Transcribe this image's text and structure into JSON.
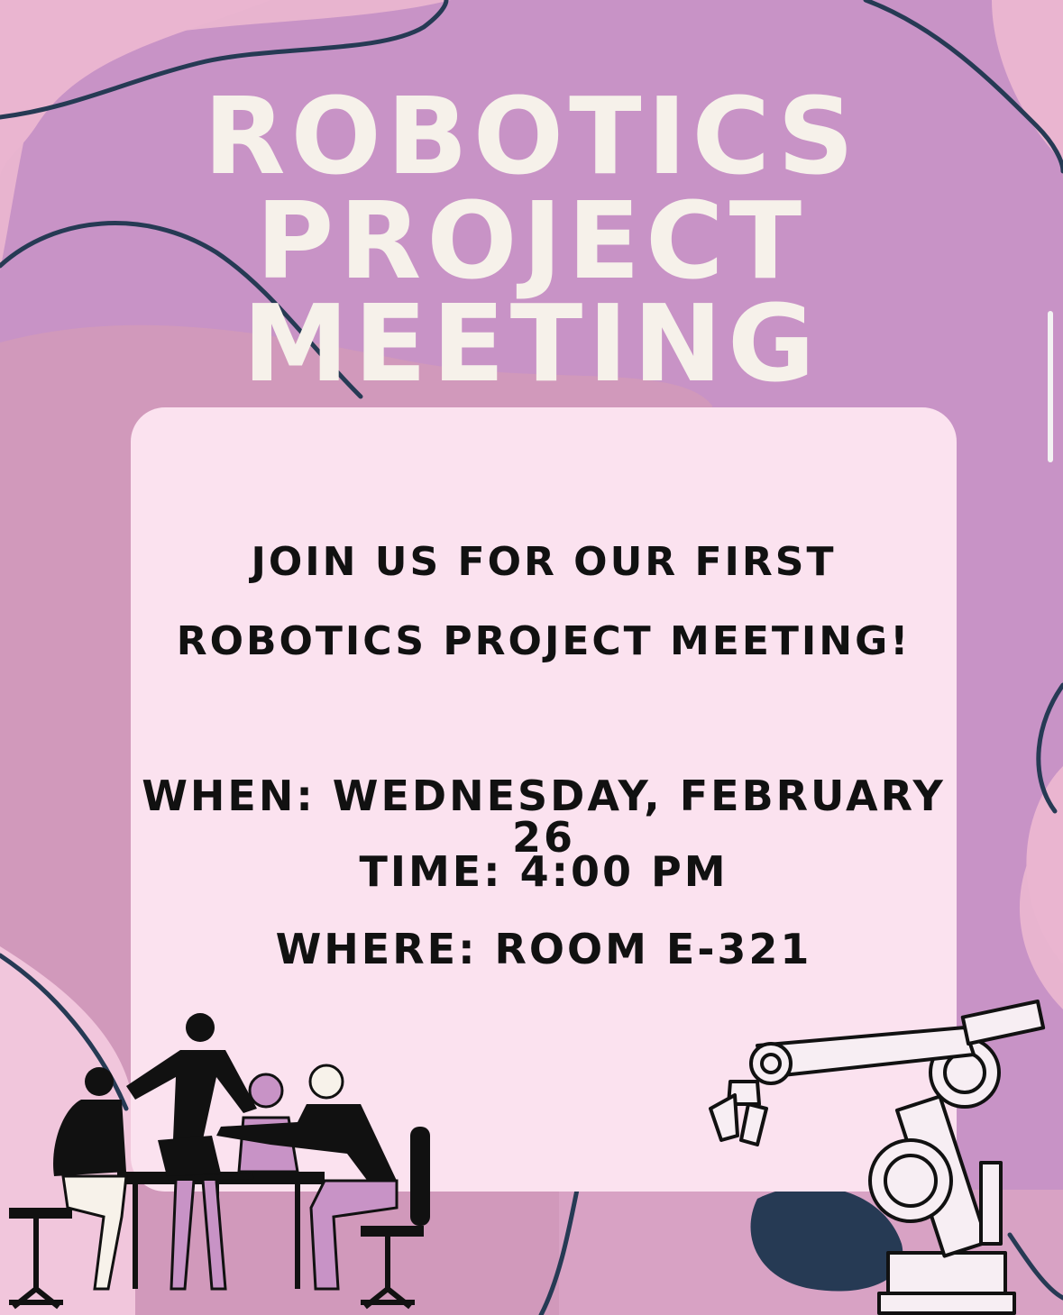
{
  "flyer": {
    "title_lines": [
      "ROBOTICS",
      "PROJECT",
      "MEETING"
    ],
    "invitation_lines": [
      "JOIN US FOR OUR FIRST",
      "ROBOTICS PROJECT MEETING!"
    ],
    "when": "WHEN: WEDNESDAY, FEBRUARY 26",
    "time": "TIME: 4:00 pm",
    "where": "WHERE: ROOM E-321"
  },
  "colors": {
    "background_pink": "#e8b4cf",
    "purple_blob": "#c893c6",
    "mauve_blob": "#d29ab8",
    "card": "#fbe2ef",
    "navy_lines": "#263a54",
    "title_text": "#f6f1ea"
  },
  "icons": {
    "people_illustration": "team-at-table-illustration",
    "robot_arm": "robot-arm-icon"
  }
}
